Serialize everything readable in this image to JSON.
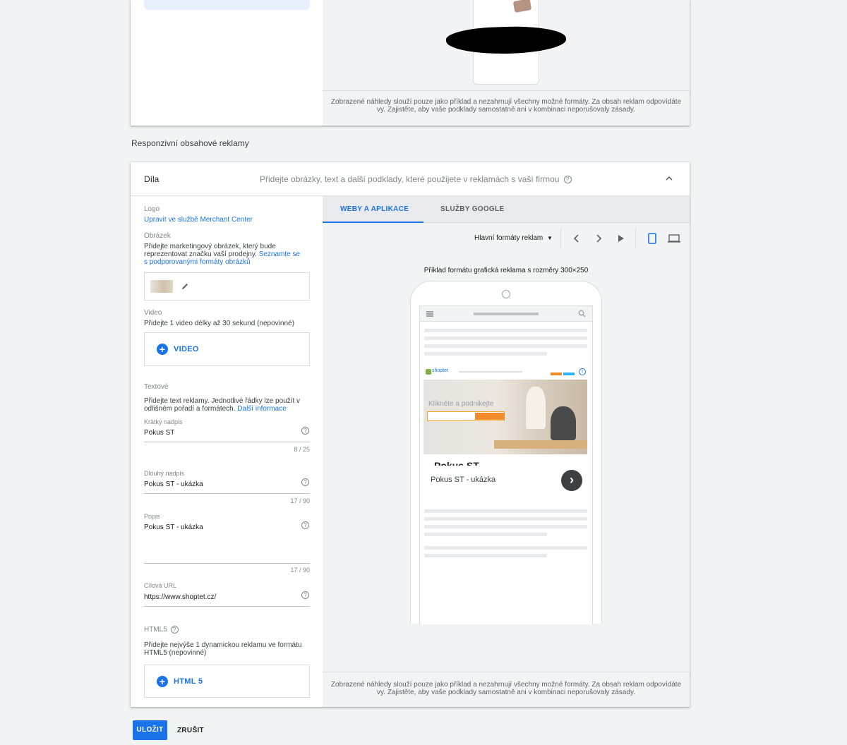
{
  "top_card": {
    "disclaimer_line1": "Zobrazené náhledy slouží pouze jako příklad a nezahrnují všechny možné formáty. Za obsah reklam odpovídáte",
    "disclaimer_line2": "vy. Zajistěte, aby vaše podklady samostatně ani v kombinaci neporušovaly zásady."
  },
  "section_title": "Responzivní obsahové reklamy",
  "card": {
    "title": "Díla",
    "description": "Přidejte obrázky, text a další podklady, které použijete v reklamách s vaší firmou",
    "help_icon": "help-circle-icon",
    "collapse_icon": "chevron-up-icon"
  },
  "assets": {
    "logo_label": "Logo",
    "logo_link": "Upravit ve službě Merchant Center",
    "image_label": "Obrázek",
    "image_text": "Přidejte marketingový obrázek, který bude reprezentovat značku vaší prodejny.",
    "image_link": "Seznamte se s podporovanými formáty obrázků",
    "video_label": "Video",
    "video_text": "Přidejte 1 video délky až 30 sekund (nepovinné)",
    "video_button": "VIDEO",
    "text_label": "Textové",
    "text_text": "Přidejte text reklamy. Jednotlivé řádky lze použít v odlišném pořadí a formátech.",
    "text_link": "Další informace",
    "short_headline_label": "Krátký nadpis",
    "short_headline_value": "Pokus ST",
    "short_headline_counter": "8 / 25",
    "long_headline_label": "Dlouhý nadpis",
    "long_headline_value": "Pokus ST - ukázka",
    "long_headline_counter": "17 / 90",
    "description_label": "Popis",
    "description_value": "Pokus ST - ukázka",
    "description_counter": "17 / 90",
    "url_label": "Cílová URL",
    "url_value": "https://www.shoptet.cz/",
    "html5_label": "HTML5",
    "html5_text": "Přidejte nejvýše 1 dynamickou reklamu ve formátu HTML5 (nepovinné)",
    "html5_button": "HTML 5"
  },
  "preview": {
    "tabs": [
      {
        "label": "WEBY A APLIKACE",
        "active": true
      },
      {
        "label": "SLUŽBY GOOGLE",
        "active": false
      }
    ],
    "format_select": "Hlavní formáty reklam",
    "example_title": "Příklad formátu grafická reklama s rozměry 300×250",
    "ad_hero_text": "Klikněte a podnikejte",
    "ad_brand": "shoptet",
    "ad_headline": "Pokus ST",
    "ad_long_headline": "Pokus ST - ukázka",
    "disclaimer_line1": "Zobrazené náhledy slouží pouze jako příklad a nezahrnují všechny možné formáty. Za obsah reklam odpovídáte",
    "disclaimer_line2": "vy. Zajistěte, aby vaše podklady samostatně ani v kombinaci neporušovaly zásady.",
    "device": "mobile"
  },
  "actions": {
    "save": "ULOŽIT",
    "cancel": "ZRUŠIT"
  },
  "colors": {
    "accent": "#1a73e8",
    "background": "#f1f3f4"
  }
}
